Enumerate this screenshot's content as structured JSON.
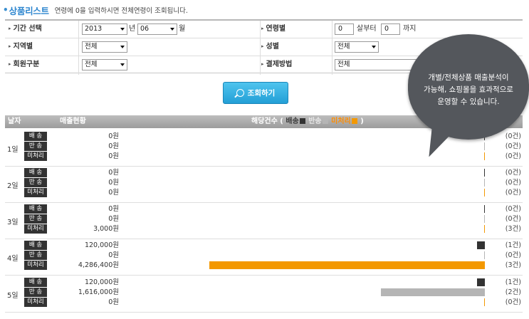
{
  "section": {
    "title": "상품리스트",
    "hint": "연령에 0을 입력하시면 전체연령이 조회됩니다."
  },
  "form": {
    "period_label": "기간 선택",
    "year_value": "2013",
    "year_suffix": "년",
    "month_value": "06",
    "month_suffix": "월",
    "age_label": "연령별",
    "age_from": "0",
    "age_from_suffix": "살부터",
    "age_to": "0",
    "age_to_suffix": "까지",
    "region_label": "지역별",
    "region_value": "전체",
    "gender_label": "성별",
    "gender_value": "전체",
    "member_label": "회원구분",
    "member_value": "전체",
    "payment_label": "결제방법",
    "payment_value": "전체"
  },
  "search_button": {
    "label": "조회하기",
    "icon": "search-icon"
  },
  "results": {
    "header": {
      "date": "날자",
      "sales": "매출현황",
      "count_prefix": "해당건수 (",
      "legend_ship": "배송",
      "legend_return": "반송",
      "legend_pending": "미처리",
      "count_suffix": ")"
    },
    "colors": {
      "ship": "#333333",
      "return": "#b5b5b5",
      "pending": "#f39800"
    },
    "max_amount": 4286400,
    "days": [
      {
        "label": "1일",
        "rows": [
          {
            "type": "ship",
            "badge": "배 송",
            "amount": "0원",
            "value": 0,
            "count": "(0건)"
          },
          {
            "type": "return",
            "badge": "반 송",
            "amount": "0원",
            "value": 0,
            "count": "(0건)"
          },
          {
            "type": "pending",
            "badge": "미처리",
            "amount": "0원",
            "value": 0,
            "count": "(0건)"
          }
        ]
      },
      {
        "label": "2일",
        "rows": [
          {
            "type": "ship",
            "badge": "배 송",
            "amount": "0원",
            "value": 0,
            "count": "(0건)"
          },
          {
            "type": "return",
            "badge": "반 송",
            "amount": "0원",
            "value": 0,
            "count": "(0건)"
          },
          {
            "type": "pending",
            "badge": "미처리",
            "amount": "0원",
            "value": 0,
            "count": "(0건)"
          }
        ]
      },
      {
        "label": "3일",
        "rows": [
          {
            "type": "ship",
            "badge": "배 송",
            "amount": "0원",
            "value": 0,
            "count": "(0건)"
          },
          {
            "type": "return",
            "badge": "반 송",
            "amount": "0원",
            "value": 0,
            "count": "(0건)"
          },
          {
            "type": "pending",
            "badge": "미처리",
            "amount": "3,000원",
            "value": 3000,
            "count": "(3건)"
          }
        ]
      },
      {
        "label": "4일",
        "rows": [
          {
            "type": "ship",
            "badge": "배 송",
            "amount": "120,000원",
            "value": 120000,
            "count": "(1건)"
          },
          {
            "type": "return",
            "badge": "반 송",
            "amount": "0원",
            "value": 0,
            "count": "(0건)"
          },
          {
            "type": "pending",
            "badge": "미처리",
            "amount": "4,286,400원",
            "value": 4286400,
            "count": "(3건)"
          }
        ]
      },
      {
        "label": "5일",
        "rows": [
          {
            "type": "ship",
            "badge": "배 송",
            "amount": "120,000원",
            "value": 120000,
            "count": "(1건)"
          },
          {
            "type": "return",
            "badge": "반 송",
            "amount": "1,616,000원",
            "value": 1616000,
            "count": "(2건)"
          },
          {
            "type": "pending",
            "badge": "미처리",
            "amount": "0원",
            "value": 0,
            "count": "(0건)"
          }
        ]
      }
    ]
  },
  "bubble": {
    "line1": "개별/전체상품 매출분석이",
    "line2": "가능해, 쇼핑몰을 효과적으로",
    "line3": "운영할 수 있습니다."
  }
}
